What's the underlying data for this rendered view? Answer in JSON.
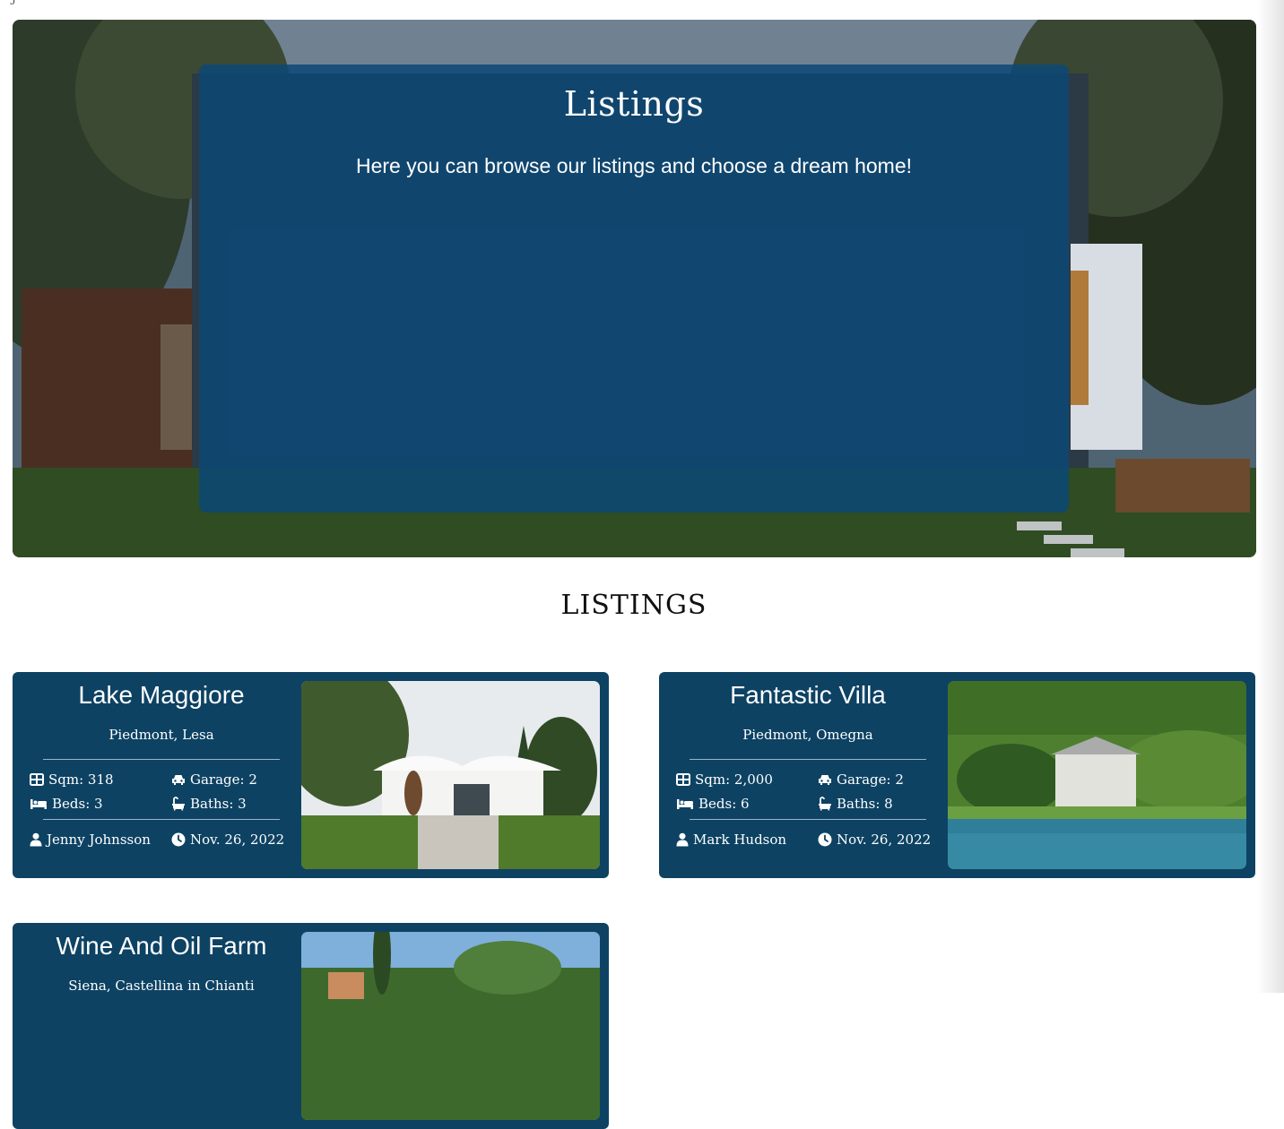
{
  "hero": {
    "title": "Listings",
    "subtitle": "Here you can browse our listings and choose a dream home!"
  },
  "section": {
    "heading": "LISTINGS"
  },
  "listings": [
    {
      "title": "Lake Maggiore",
      "location": "Piedmont, Lesa",
      "sqm": "Sqm: 318",
      "garage": "Garage: 2",
      "beds": "Beds: 3",
      "baths": "Baths: 3",
      "realtor": "Jenny Johnsson",
      "date": "Nov. 26, 2022"
    },
    {
      "title": "Fantastic Villa",
      "location": "Piedmont, Omegna",
      "sqm": "Sqm: 2,000",
      "garage": "Garage: 2",
      "beds": "Beds: 6",
      "baths": "Baths: 8",
      "realtor": "Mark Hudson",
      "date": "Nov. 26, 2022"
    },
    {
      "title": "Wine And Oil Farm",
      "location": "Siena, Castellina in Chianti"
    }
  ],
  "icons": {
    "sqm": "grid-icon",
    "garage": "car-icon",
    "beds": "bed-icon",
    "baths": "bath-icon",
    "realtor": "user-icon",
    "date": "clock-icon"
  },
  "colors": {
    "card_bg": "#0d4263",
    "hero_overlay": "#0c4876"
  }
}
